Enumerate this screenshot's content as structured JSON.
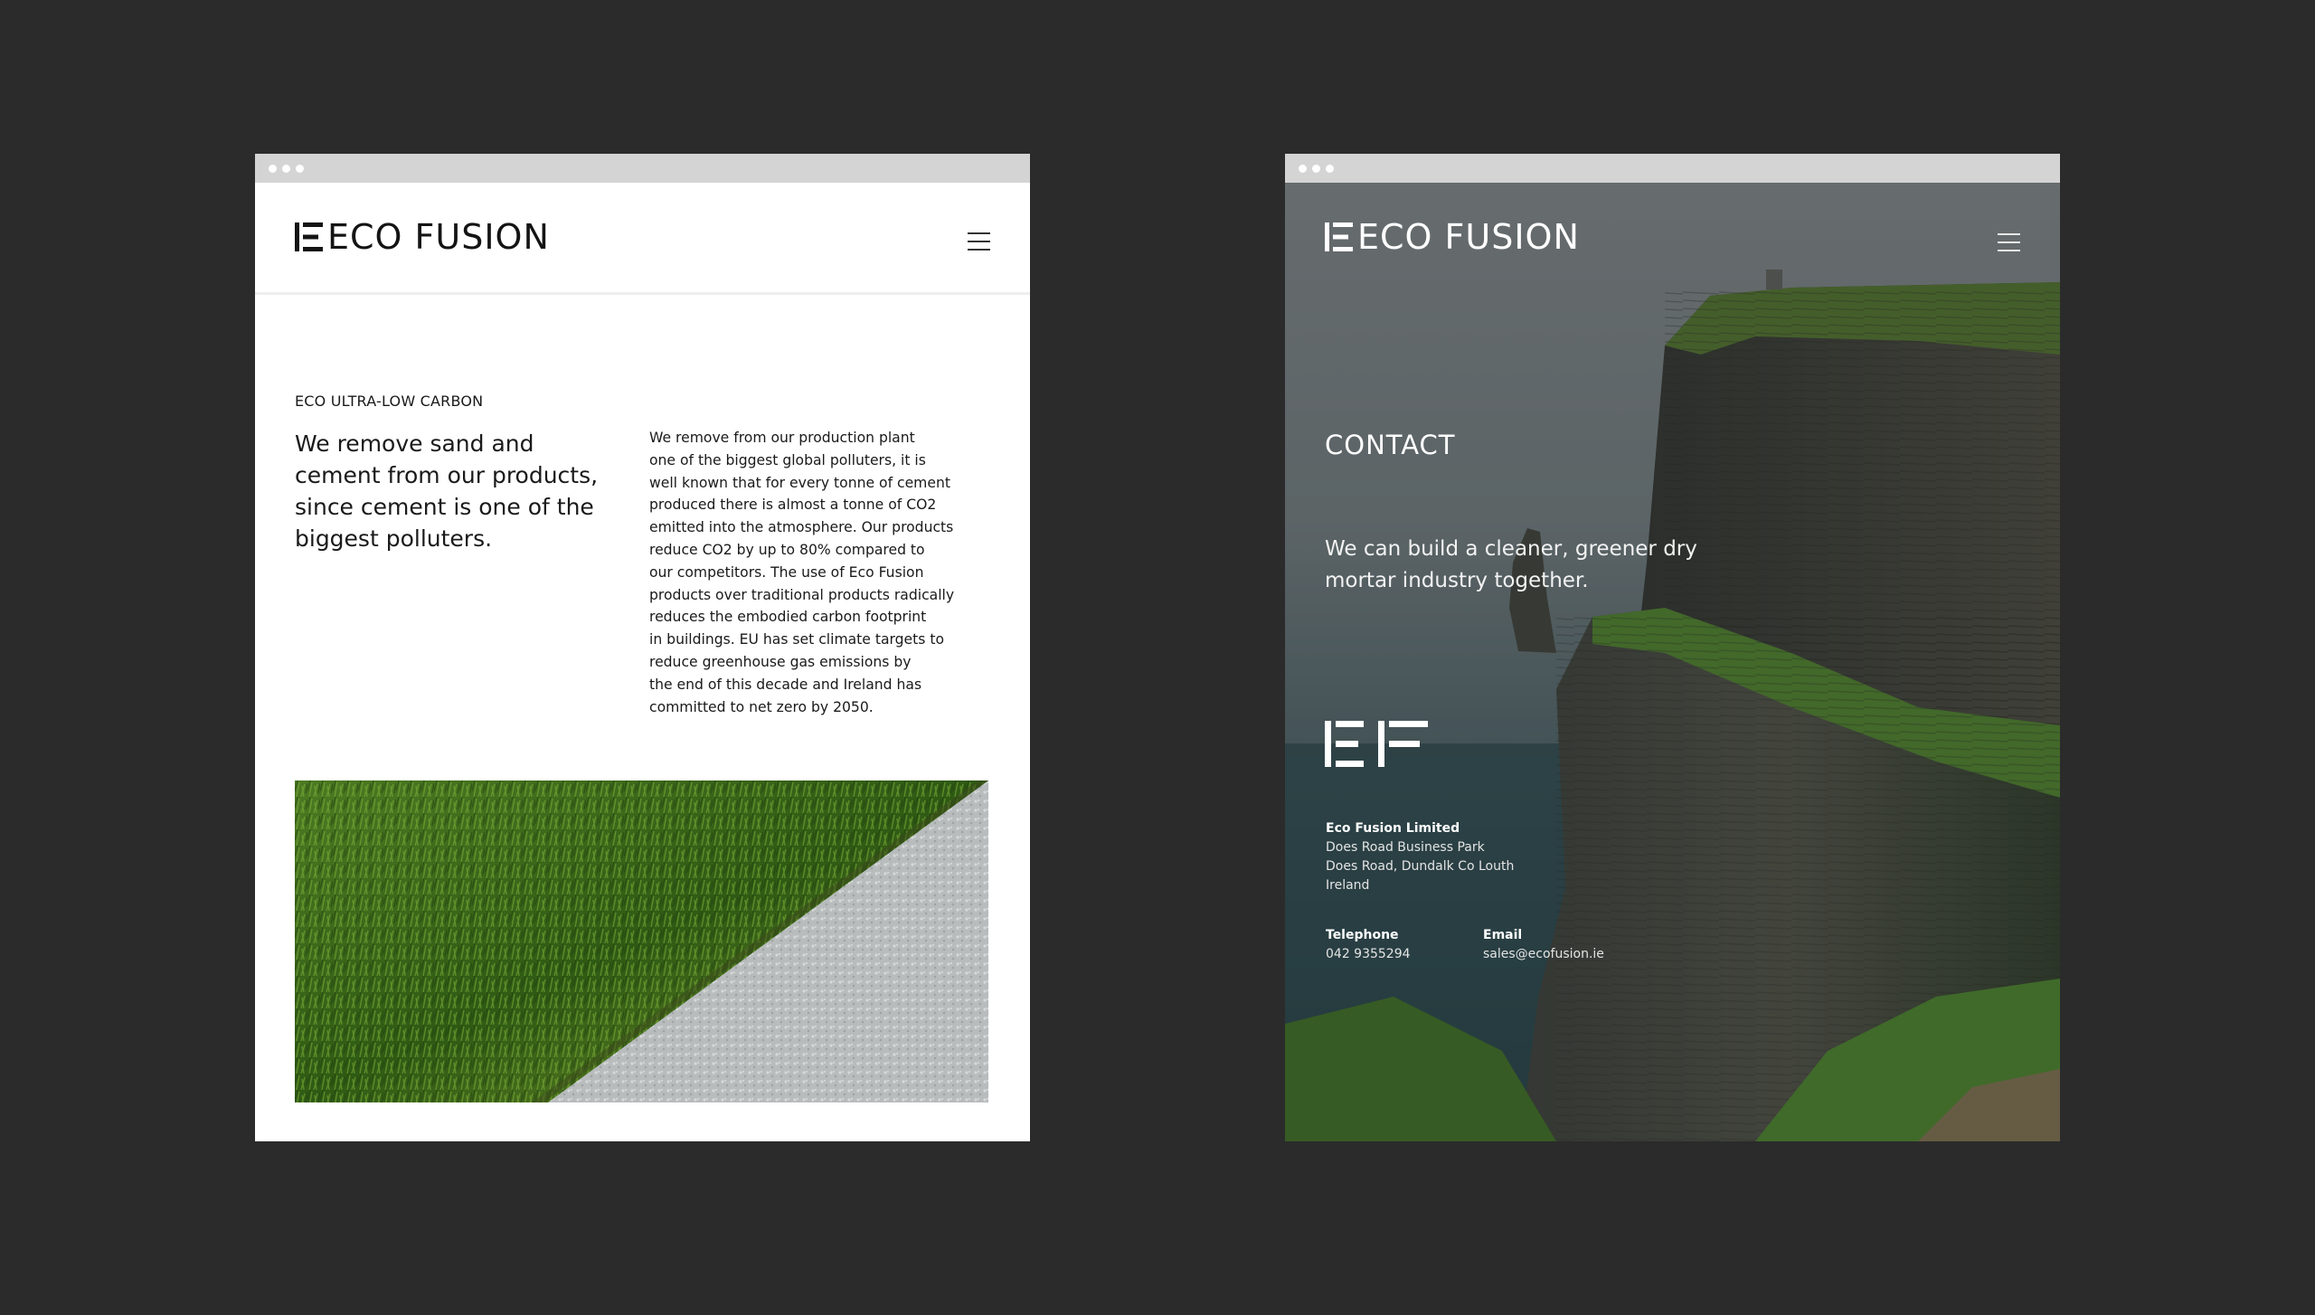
{
  "left_page": {
    "brand": {
      "logo_text": "ECO FUSION"
    },
    "section_eyebrow": "ECO ULTRA-LOW CARBON",
    "headline": "We remove sand and cement from our products, since cement is one of the biggest polluters.",
    "body": "We remove from our production plant\none of the biggest global polluters, it is\nwell known that for every tonne of cement\nproduced there is almost a tonne of CO2\nemitted into the atmosphere. Our products\nreduce CO2 by up to 80% compared to\nour competitors. The use of Eco Fusion\nproducts over traditional products radically\nreduces the embodied carbon footprint\nin buildings. EU has set climate targets to\nreduce greenhouse gas emissions by\nthe end of this decade and Ireland has\ncommitted to net zero by 2050."
  },
  "right_page": {
    "brand": {
      "logo_text": "ECO FUSION"
    },
    "title": "CONTACT",
    "tagline": "We can build a cleaner, greener dry\nmortar industry together.",
    "address": {
      "company": "Eco Fusion Limited",
      "line1": "Does Road Business Park",
      "line2": "Does Road, Dundalk Co Louth",
      "line3": "Ireland"
    },
    "telephone": {
      "label": "Telephone",
      "value": "042 9355294"
    },
    "email": {
      "label": "Email",
      "value": "sales@ecofusion.ie"
    }
  },
  "colors": {
    "backdrop": "#2b2b2b",
    "titlebar": "#d4d4d4",
    "text_dark": "#1a1a1a",
    "text_light": "#ffffff"
  },
  "icons": [
    "menu-icon",
    "ef-logo-mark"
  ]
}
